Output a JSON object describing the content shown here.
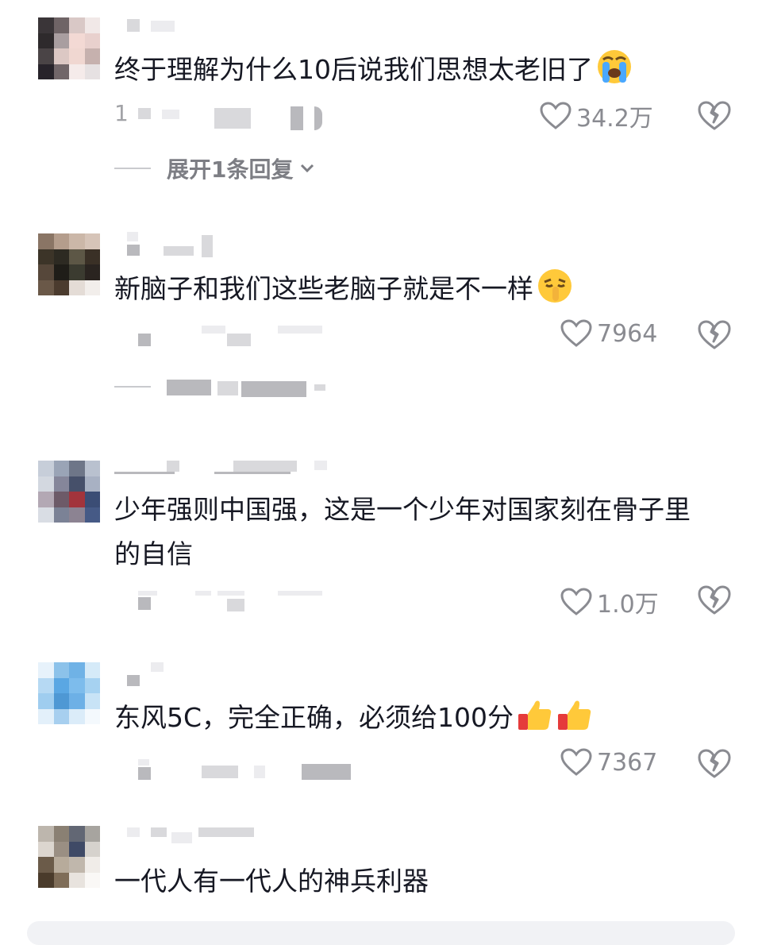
{
  "comments": [
    {
      "text": "终于理解为什么10后说我们思想太老旧了",
      "emoji": "loudly-crying-face",
      "meta_prefix": "1",
      "likes": "34.2万",
      "expand_label": "展开1条回复"
    },
    {
      "text": "新脑子和我们这些老脑子就是不一样",
      "emoji": "shushing-face",
      "likes": "7964"
    },
    {
      "text_line1": "少年强则中国强，这是一个少年对国家刻在骨子里",
      "text_line2": "的自信",
      "likes": "1.0万"
    },
    {
      "text": "东风5C，完全正确，必须给100分",
      "emoji": "thumbs-up",
      "likes": "7367"
    },
    {
      "text": "一代人有一代人的神兵利器"
    }
  ],
  "colors": {
    "text": "#161823",
    "muted": "#8a8b91",
    "icon": "#8a8b91",
    "emoji_yellow": "#ffc93a",
    "thumb_cuff": "#e53b3b"
  },
  "icons": {
    "like": "heart-outline-icon",
    "dislike": "broken-heart-icon",
    "expand": "chevron-down-icon"
  }
}
